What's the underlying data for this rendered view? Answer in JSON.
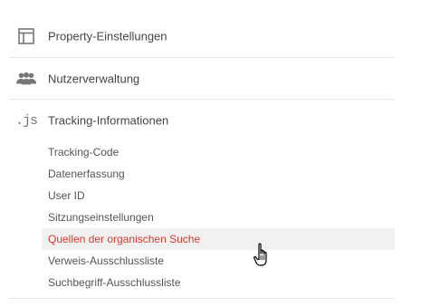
{
  "sections": [
    {
      "label": "Property-Einstellungen",
      "icon": "property-layout-icon"
    },
    {
      "label": "Nutzerverwaltung",
      "icon": "users-icon"
    },
    {
      "label": "Tracking-Informationen",
      "icon": "js-icon",
      "icon_text": ".js"
    }
  ],
  "tracking_items": [
    {
      "label": "Tracking-Code"
    },
    {
      "label": "Datenerfassung"
    },
    {
      "label": "User ID"
    },
    {
      "label": "Sitzungseinstellungen"
    },
    {
      "label": "Quellen der organischen Suche",
      "active": true
    },
    {
      "label": "Verweis-Ausschlussliste"
    },
    {
      "label": "Suchbegriff-Ausschlussliste"
    }
  ],
  "colors": {
    "active_text": "#d83a2e",
    "active_bg": "#f1f1f1",
    "icon": "#777777"
  },
  "cursor": "hand-pointer-icon"
}
